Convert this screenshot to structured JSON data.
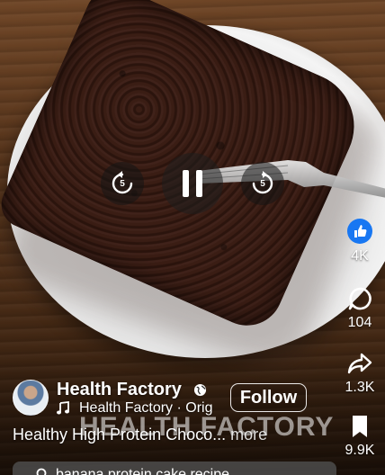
{
  "video": {
    "description_icon": "chocolate-cake-on-plate"
  },
  "controls": {
    "replay_back_seconds": "5",
    "replay_fwd_seconds": "5"
  },
  "rail": {
    "like_count": "4K",
    "comment_count": "104",
    "share_count": "1.3K",
    "save_count": "9.9K"
  },
  "author": {
    "name": "Health Factory",
    "follow_label": "Follow"
  },
  "audio": {
    "text": "Health Factory · Orig"
  },
  "watermark": "HEALTH FACTORY",
  "caption": {
    "text": "Healthy High Protein Choco...",
    "more": "more"
  },
  "search": {
    "text": "banana protein cake recipe"
  },
  "colors": {
    "like_blue": "#1877f2"
  }
}
